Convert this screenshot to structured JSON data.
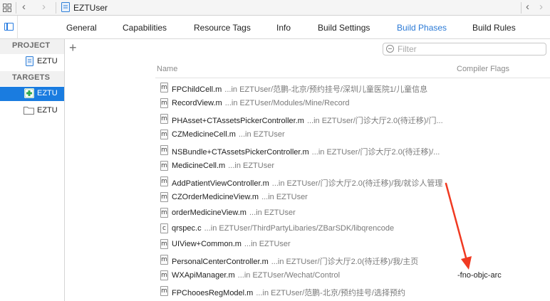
{
  "jumpbar": {
    "title": "EZTUser",
    "back_glyph": "‹",
    "forward_glyph": "›",
    "issue_glyph": "‹",
    "next_glyph": "›"
  },
  "tabs": [
    {
      "label": "General",
      "active": false
    },
    {
      "label": "Capabilities",
      "active": false
    },
    {
      "label": "Resource Tags",
      "active": false
    },
    {
      "label": "Info",
      "active": false
    },
    {
      "label": "Build Settings",
      "active": false
    },
    {
      "label": "Build Phases",
      "active": true
    },
    {
      "label": "Build Rules",
      "active": false
    }
  ],
  "sidebar": {
    "project_header": "PROJECT",
    "project_item": "EZTU",
    "targets_header": "TARGETS",
    "targets": [
      {
        "label": "EZTU",
        "selected": true
      },
      {
        "label": "EZTU",
        "selected": false
      }
    ]
  },
  "toolbar": {
    "add_glyph": "+",
    "filter_placeholder": "Filter"
  },
  "table": {
    "col_name": "Name",
    "col_flags": "Compiler Flags",
    "rows": [
      {
        "icon": "m",
        "name": "FPChildCell.m",
        "path": "...in EZTUser/范鹏-北京/预约挂号/深圳儿童医院1/儿童信息",
        "flags": ""
      },
      {
        "icon": "m",
        "name": "RecordView.m",
        "path": "...in EZTUser/Modules/Mine/Record",
        "flags": ""
      },
      {
        "icon": "m",
        "name": "PHAsset+CTAssetsPickerController.m",
        "path": "...in EZTUser/门诊大厅2.0(待迁移)/门...",
        "flags": ""
      },
      {
        "icon": "m",
        "name": "CZMedicineCell.m",
        "path": "...in EZTUser",
        "flags": ""
      },
      {
        "icon": "m",
        "name": "NSBundle+CTAssetsPickerController.m",
        "path": "...in EZTUser/门诊大厅2.0(待迁移)/...",
        "flags": ""
      },
      {
        "icon": "m",
        "name": "MedicineCell.m",
        "path": "...in EZTUser",
        "flags": ""
      },
      {
        "icon": "m",
        "name": "AddPatientViewController.m",
        "path": "...in EZTUser/门诊大厅2.0(待迁移)/我/就诊人管理",
        "flags": ""
      },
      {
        "icon": "m",
        "name": "CZOrderMedicineView.m",
        "path": "...in EZTUser",
        "flags": ""
      },
      {
        "icon": "m",
        "name": "orderMedicineView.m",
        "path": "...in EZTUser",
        "flags": ""
      },
      {
        "icon": "c",
        "name": "qrspec.c",
        "path": "...in EZTUser/ThirdPartyLibaries/ZBarSDK/libqrencode",
        "flags": ""
      },
      {
        "icon": "m",
        "name": "UIView+Common.m",
        "path": "...in EZTUser",
        "flags": ""
      },
      {
        "icon": "m",
        "name": "PersonalCenterController.m",
        "path": "...in EZTUser/门诊大厅2.0(待迁移)/我/主页",
        "flags": ""
      },
      {
        "icon": "m",
        "name": "WXApiManager.m",
        "path": "...in EZTUser/Wechat/Control",
        "flags": "-fno-objc-arc"
      },
      {
        "icon": "m",
        "name": "FPChooesRegModel.m",
        "path": "...in EZTUser/范鹏-北京/预约挂号/选择预约",
        "flags": ""
      }
    ]
  },
  "colors": {
    "accent": "#1a7ce0",
    "active_tab": "#2b7ad6",
    "annotation_arrow": "#f03a22"
  },
  "icons": {
    "jumpbar_grid": "grid-icon",
    "jumpbar_file": "project-file-icon",
    "sidebar_toggle": "sidebar-toggle-icon",
    "filter": "filter-icon",
    "app_target": "app-target-icon",
    "folder_target": "folder-icon"
  }
}
